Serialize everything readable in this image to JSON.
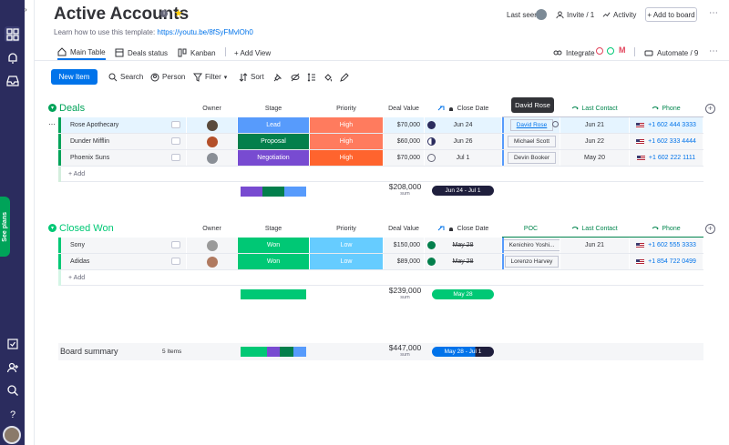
{
  "board": {
    "title": "Active Accounts",
    "subtitle_prefix": "Learn how to use this template: ",
    "subtitle_link": "https://youtu.be/8fSyFMvlOh0"
  },
  "header": {
    "last_seen": "Last seen",
    "invite": "Invite / 1",
    "activity": "Activity",
    "add_to_board": "+ Add to board",
    "integrate": "Integrate",
    "automate": "Automate / 9"
  },
  "tabs": {
    "main_table": "Main Table",
    "deals_status": "Deals status",
    "kanban": "Kanban",
    "add_view": "+ Add View"
  },
  "toolbar": {
    "new_item": "New Item",
    "search": "Search",
    "person": "Person",
    "filter": "Filter",
    "sort": "Sort"
  },
  "rail": {
    "see_plans": "See plans"
  },
  "tooltip": "David Rose",
  "groups": {
    "deals": {
      "name": "Deals",
      "color": "#00a359",
      "columns": {
        "owner": "Owner",
        "stage": "Stage",
        "priority": "Priority",
        "deal_value": "Deal Value",
        "close_date": "Close Date",
        "last_contact": "Last Contact",
        "phone": "Phone"
      },
      "rows": [
        {
          "name": "Rose Apothecary",
          "stage": "Lead",
          "stage_color": "#579bfc",
          "priority": "High",
          "priority_color": "#ff7b5e",
          "value": "$70,000",
          "close_date": "Jun 24",
          "poc": "David Rose",
          "last_contact": "Jun 21",
          "phone": "+1 602 444 3333"
        },
        {
          "name": "Dunder Mifflin",
          "stage": "Proposal",
          "stage_color": "#037f4c",
          "priority": "High",
          "priority_color": "#ff7b5e",
          "value": "$60,000",
          "close_date": "Jun 26",
          "poc": "Michael Scott",
          "last_contact": "Jun 22",
          "phone": "+1 602 333 4444"
        },
        {
          "name": "Phoenix Suns",
          "stage": "Negotiation",
          "stage_color": "#784bd1",
          "priority": "High",
          "priority_color": "#ff642e",
          "value": "$70,000",
          "close_date": "Jul 1",
          "poc": "Devin Booker",
          "last_contact": "May 20",
          "phone": "+1 602 222 1111"
        }
      ],
      "add": "+ Add",
      "sum_value": "$208,000",
      "sum_label": "sum",
      "date_range": "Jun 24 - Jul 1"
    },
    "closed": {
      "name": "Closed Won",
      "color": "#00c875",
      "columns": {
        "owner": "Owner",
        "stage": "Stage",
        "priority": "Priority",
        "deal_value": "Deal Value",
        "close_date": "Close Date",
        "poc": "POC",
        "last_contact": "Last Contact",
        "phone": "Phone"
      },
      "rows": [
        {
          "name": "Sony",
          "stage": "Won",
          "stage_color": "#00c875",
          "priority": "Low",
          "priority_color": "#66ccff",
          "value": "$150,000",
          "close_date": "May 28",
          "poc": "Kenichiro Yoshi...",
          "last_contact": "Jun 21",
          "phone": "+1 602 555 3333"
        },
        {
          "name": "Adidas",
          "stage": "Won",
          "stage_color": "#00c875",
          "priority": "Low",
          "priority_color": "#66ccff",
          "value": "$89,000",
          "close_date": "May 28",
          "poc": "Lorenzo Harvey",
          "last_contact": "",
          "phone": "+1 854 722 0499"
        }
      ],
      "add": "+ Add",
      "sum_value": "$239,000",
      "sum_label": "sum",
      "date_range": "May 28"
    }
  },
  "summary": {
    "label": "Board summary",
    "items": "5 Items",
    "sum_value": "$447,000",
    "sum_label": "sum",
    "date_range": "May 28 - Jul 1"
  }
}
